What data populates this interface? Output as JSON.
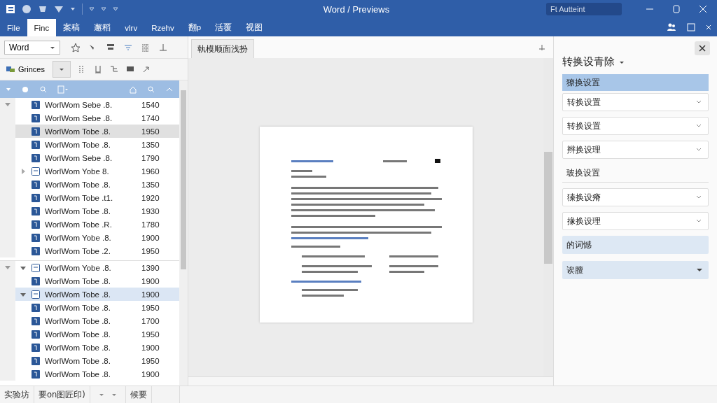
{
  "window": {
    "title": "Word / Previews",
    "search": {
      "value": "Ft Autteint"
    }
  },
  "ribbon_tabs": [
    {
      "label": "File",
      "selected": false
    },
    {
      "label": "Finc",
      "selected": true
    },
    {
      "label": "案稿",
      "selected": false
    },
    {
      "label": "邂稻",
      "selected": false
    },
    {
      "label": "vlrv",
      "selected": false
    },
    {
      "label": "Rzehv",
      "selected": false
    },
    {
      "label": "翻p",
      "selected": false
    },
    {
      "label": "活覆",
      "selected": false
    },
    {
      "label": "视图",
      "selected": false
    }
  ],
  "left_toolbar": {
    "dropdown": {
      "value": "Word"
    },
    "button": "Grinces"
  },
  "document_tab": {
    "label": "執模顺面浅扮",
    "selected": true
  },
  "file_list": {
    "groups": [
      {
        "expanded": true,
        "rows": [
          {
            "name": "WorlWom Sebe .8.",
            "value": "1540",
            "kind": "file",
            "selected": false,
            "hovered": false
          },
          {
            "name": "WorlWom Sebe .8.",
            "value": "1740",
            "kind": "file",
            "selected": false,
            "hovered": false
          },
          {
            "name": "WorlWom Tobe .8.",
            "value": "1950",
            "kind": "file",
            "selected": false,
            "hovered": true
          },
          {
            "name": "WorlWom Tobe .8.",
            "value": "1350",
            "kind": "file",
            "selected": false,
            "hovered": false
          },
          {
            "name": "WorlWom Sebe .8.",
            "value": "1790",
            "kind": "file",
            "selected": false,
            "hovered": false
          },
          {
            "name": "WorlWom Yobe 8.",
            "value": "1960",
            "kind": "folder",
            "selected": false,
            "hovered": false,
            "expanded": false
          },
          {
            "name": "WorlWom Tobe .8.",
            "value": "1350",
            "kind": "file",
            "selected": false,
            "hovered": false
          },
          {
            "name": "WorlWom Tobe .t1.",
            "value": "1920",
            "kind": "file",
            "selected": false,
            "hovered": false
          },
          {
            "name": "WorlWom Tobe .8.",
            "value": "1930",
            "kind": "file",
            "selected": false,
            "hovered": false
          },
          {
            "name": "WorlWom Tobe .R.",
            "value": "1780",
            "kind": "file",
            "selected": false,
            "hovered": false
          },
          {
            "name": "WorlWom Yobe .8.",
            "value": "1900",
            "kind": "file",
            "selected": false,
            "hovered": false
          },
          {
            "name": "WorlWom Tobe .2.",
            "value": "1950",
            "kind": "file",
            "selected": false,
            "hovered": false
          }
        ]
      },
      {
        "expanded": true,
        "rows": [
          {
            "name": "WorlWom Yobe .8.",
            "value": "1390",
            "kind": "folder",
            "selected": false,
            "hovered": false,
            "expanded": true
          },
          {
            "name": "WorlWom Tobe .8.",
            "value": "1900",
            "kind": "file",
            "selected": false,
            "hovered": false
          },
          {
            "name": "WorlWom Tobe .8.",
            "value": "1900",
            "kind": "folder",
            "selected": true,
            "hovered": false,
            "expanded": true
          },
          {
            "name": "WorlWom Tobe .8.",
            "value": "1950",
            "kind": "file",
            "selected": false,
            "hovered": false
          },
          {
            "name": "WorlWom Tobe .8.",
            "value": "1700",
            "kind": "file",
            "selected": false,
            "hovered": false
          },
          {
            "name": "WorlWom Tobe .8.",
            "value": "1950",
            "kind": "file",
            "selected": false,
            "hovered": false
          },
          {
            "name": "WorlWom Tobe .8.",
            "value": "1900",
            "kind": "file",
            "selected": false,
            "hovered": false
          },
          {
            "name": "WorlWom Tobe .8.",
            "value": "1950",
            "kind": "file",
            "selected": false,
            "hovered": false
          },
          {
            "name": "WorlWom Tobe .8.",
            "value": "1900",
            "kind": "file",
            "selected": false,
            "hovered": false
          }
        ]
      }
    ]
  },
  "right_panel": {
    "title": "转换设青除",
    "items": [
      {
        "kind": "header",
        "label": "獠换设置",
        "selected": true
      },
      {
        "kind": "dropdown",
        "label": "转换设置",
        "selected": false
      },
      {
        "kind": "dropdown",
        "label": "转换设置",
        "selected": false
      },
      {
        "kind": "dropdown",
        "label": "辫换设理",
        "selected": false
      },
      {
        "kind": "plain",
        "label": "玻换设置",
        "selected": false
      },
      {
        "kind": "dropdown",
        "label": "獉换设瘠",
        "selected": false
      },
      {
        "kind": "dropdown",
        "label": "掾换设理",
        "selected": false
      },
      {
        "kind": "note",
        "label": "的词憾",
        "selected": false
      },
      {
        "kind": "filled",
        "label": "诶膻",
        "selected": false
      }
    ]
  },
  "status_bar": {
    "items": [
      "实验坊",
      "要on图匠印)"
    ],
    "right_label": "候要"
  }
}
